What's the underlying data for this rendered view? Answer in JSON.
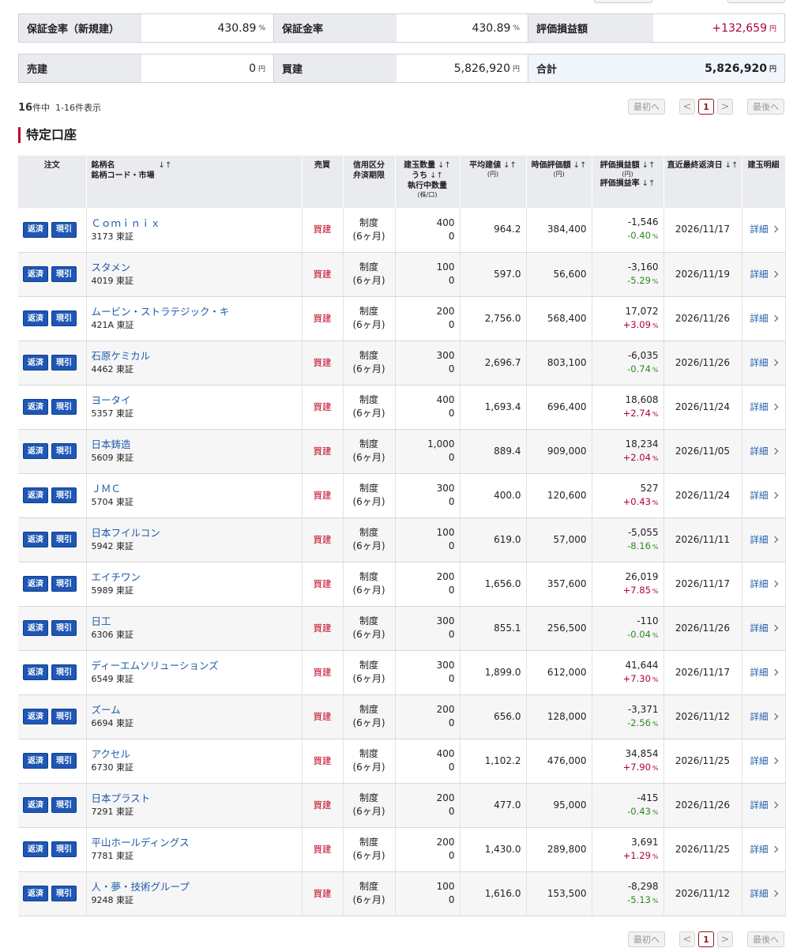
{
  "summary": {
    "row1": [
      {
        "label": "保証金率（新規建）",
        "value": "430.89",
        "unit": "%"
      },
      {
        "label": "保証金率",
        "value": "430.89",
        "unit": "%"
      },
      {
        "label": "評価損益額",
        "value": "+132,659",
        "unit": "円"
      }
    ],
    "row2": [
      {
        "label": "売建",
        "value": "0",
        "unit": "円"
      },
      {
        "label": "買建",
        "value": "5,826,920",
        "unit": "円"
      },
      {
        "label": "合計",
        "value": "5,826,920",
        "unit": "円"
      }
    ]
  },
  "count": {
    "total": "16",
    "suffix": "件中",
    "range": "1-16件表示"
  },
  "pager": {
    "first": "最初へ",
    "prev": "<",
    "current": "1",
    "next": ">",
    "last": "最後へ"
  },
  "section_title": "特定口座",
  "table": {
    "headers": {
      "order": "注文",
      "name": "銘柄名",
      "name_sub": "銘柄コード・市場",
      "side": "売買",
      "credit": "信用区分",
      "credit_sub": "弁済期限",
      "qty": "建玉数量",
      "qty_sub1": "うち",
      "qty_sub2": "執行中数量",
      "qty_unit": "(株/口)",
      "avg": "平均建値",
      "avg_unit": "(円)",
      "value": "時価評価額",
      "value_unit": "(円)",
      "pl": "評価損益額",
      "pl_unit": "(円)",
      "pl_rate": "評価損益率",
      "date": "直近最終返済日",
      "detail": "建玉明細",
      "sort_a": "↓↑",
      "sort_b": "↓↑"
    },
    "labels": {
      "repay": "返済",
      "genbiki": "現引",
      "buy": "買建",
      "credit1": "制度",
      "credit2": "(6ヶ月)",
      "detail": "詳細",
      "pct": "%"
    },
    "rows": [
      {
        "name": "Ｃｏｍｉｎｉｘ",
        "code": "3173 東証",
        "qty": "400",
        "exec": "0",
        "avg": "964.2",
        "value": "384,400",
        "pl": "-1,546",
        "rate": "-0.40",
        "sign": "neg",
        "date": "2026/11/17"
      },
      {
        "name": "スタメン",
        "code": "4019 東証",
        "qty": "100",
        "exec": "0",
        "avg": "597.0",
        "value": "56,600",
        "pl": "-3,160",
        "rate": "-5.29",
        "sign": "neg",
        "date": "2026/11/19"
      },
      {
        "name": "ムービン・ストラテジック・キ",
        "code": "421A 東証",
        "qty": "200",
        "exec": "0",
        "avg": "2,756.0",
        "value": "568,400",
        "pl": "17,072",
        "rate": "+3.09",
        "sign": "pos",
        "date": "2026/11/26"
      },
      {
        "name": "石原ケミカル",
        "code": "4462 東証",
        "qty": "300",
        "exec": "0",
        "avg": "2,696.7",
        "value": "803,100",
        "pl": "-6,035",
        "rate": "-0.74",
        "sign": "neg",
        "date": "2026/11/26"
      },
      {
        "name": "ヨータイ",
        "code": "5357 東証",
        "qty": "400",
        "exec": "0",
        "avg": "1,693.4",
        "value": "696,400",
        "pl": "18,608",
        "rate": "+2.74",
        "sign": "pos",
        "date": "2026/11/24"
      },
      {
        "name": "日本鋳造",
        "code": "5609 東証",
        "qty": "1,000",
        "exec": "0",
        "avg": "889.4",
        "value": "909,000",
        "pl": "18,234",
        "rate": "+2.04",
        "sign": "pos",
        "date": "2026/11/05"
      },
      {
        "name": "ＪＭＣ",
        "code": "5704 東証",
        "qty": "300",
        "exec": "0",
        "avg": "400.0",
        "value": "120,600",
        "pl": "527",
        "rate": "+0.43",
        "sign": "pos",
        "date": "2026/11/24"
      },
      {
        "name": "日本フイルコン",
        "code": "5942 東証",
        "qty": "100",
        "exec": "0",
        "avg": "619.0",
        "value": "57,000",
        "pl": "-5,055",
        "rate": "-8.16",
        "sign": "neg",
        "date": "2026/11/11"
      },
      {
        "name": "エイチワン",
        "code": "5989 東証",
        "qty": "200",
        "exec": "0",
        "avg": "1,656.0",
        "value": "357,600",
        "pl": "26,019",
        "rate": "+7.85",
        "sign": "pos",
        "date": "2026/11/17"
      },
      {
        "name": "日工",
        "code": "6306 東証",
        "qty": "300",
        "exec": "0",
        "avg": "855.1",
        "value": "256,500",
        "pl": "-110",
        "rate": "-0.04",
        "sign": "neg",
        "date": "2026/11/26"
      },
      {
        "name": "ディーエムソリューションズ",
        "code": "6549 東証",
        "qty": "300",
        "exec": "0",
        "avg": "1,899.0",
        "value": "612,000",
        "pl": "41,644",
        "rate": "+7.30",
        "sign": "pos",
        "date": "2026/11/17"
      },
      {
        "name": "ズーム",
        "code": "6694 東証",
        "qty": "200",
        "exec": "0",
        "avg": "656.0",
        "value": "128,000",
        "pl": "-3,371",
        "rate": "-2.56",
        "sign": "neg",
        "date": "2026/11/12"
      },
      {
        "name": "アクセル",
        "code": "6730 東証",
        "qty": "400",
        "exec": "0",
        "avg": "1,102.2",
        "value": "476,000",
        "pl": "34,854",
        "rate": "+7.90",
        "sign": "pos",
        "date": "2026/11/25"
      },
      {
        "name": "日本プラスト",
        "code": "7291 東証",
        "qty": "200",
        "exec": "0",
        "avg": "477.0",
        "value": "95,000",
        "pl": "-415",
        "rate": "-0.43",
        "sign": "neg",
        "date": "2026/11/26"
      },
      {
        "name": "平山ホールディングス",
        "code": "7781 東証",
        "qty": "200",
        "exec": "0",
        "avg": "1,430.0",
        "value": "289,800",
        "pl": "3,691",
        "rate": "+1.29",
        "sign": "pos",
        "date": "2026/11/25"
      },
      {
        "name": "人・夢・技術グループ",
        "code": "9248 東証",
        "qty": "100",
        "exec": "0",
        "avg": "1,616.0",
        "value": "153,500",
        "pl": "-8,298",
        "rate": "-5.13",
        "sign": "neg",
        "date": "2026/11/12"
      }
    ]
  },
  "colors": {
    "positive": "#b0003a",
    "negative": "#2a8a1a",
    "button": "#1f57b5",
    "link": "#1f5ba8",
    "accent": "#c0001f"
  }
}
